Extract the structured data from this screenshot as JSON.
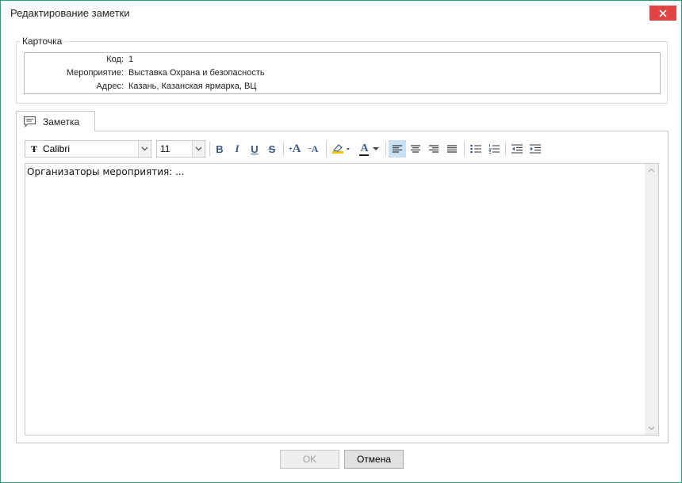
{
  "window": {
    "title": "Редактирование заметки"
  },
  "card": {
    "legend": "Карточка",
    "fields": [
      {
        "label": "Код:",
        "value": "1"
      },
      {
        "label": "Мероприятие:",
        "value": "Выставка Охрана и безопасность"
      },
      {
        "label": "Адрес:",
        "value": "Казань,  Казанская ярмарка, ВЦ"
      }
    ]
  },
  "tab": {
    "label": "Заметка",
    "icon": "comment-icon"
  },
  "toolbar": {
    "font_glyph": "Ŧ",
    "font_name": "Calibri",
    "font_size": "11",
    "bold": "B",
    "italic": "I",
    "underline": "U",
    "strike": "S",
    "grow": "A",
    "shrink": "A",
    "font_color": "A",
    "active_align": "align-left",
    "accent_color": "#3b5a86"
  },
  "editor": {
    "text": "Организаторы мероприятия: ..."
  },
  "buttons": {
    "ok": "OK",
    "cancel": "Отмена"
  }
}
